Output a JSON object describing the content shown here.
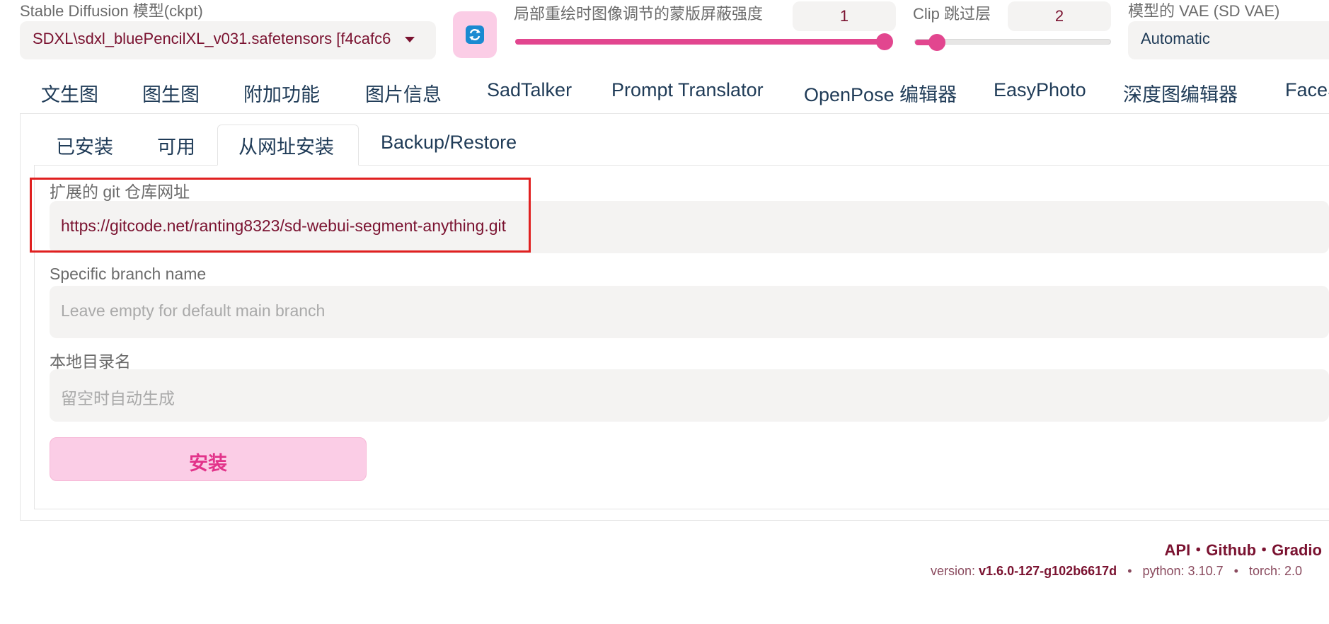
{
  "header": {
    "ckpt_label": "Stable Diffusion 模型(ckpt)",
    "ckpt_value": "SDXL\\sdxl_bluePencilXL_v031.safetensors [f4cafc6",
    "refresh_icon": "refresh-icon",
    "mask_strength_label": "局部重绘时图像调节的蒙版屏蔽强度",
    "mask_strength_value": "1",
    "mask_strength_fraction": 1.0,
    "clip_skip_label": "Clip 跳过层",
    "clip_skip_value": "2",
    "clip_skip_fraction": 0.12,
    "vae_label": "模型的 VAE (SD VAE)",
    "vae_value": "Automatic"
  },
  "main_tabs": [
    {
      "label": "文生图"
    },
    {
      "label": "图生图"
    },
    {
      "label": "附加功能"
    },
    {
      "label": "图片信息"
    },
    {
      "label": "SadTalker"
    },
    {
      "label": "Prompt Translator"
    },
    {
      "label": "OpenPose 编辑器"
    },
    {
      "label": "EasyPhoto"
    },
    {
      "label": "深度图编辑器"
    },
    {
      "label": "FaceS"
    }
  ],
  "sub_tabs": [
    {
      "label": "已安装"
    },
    {
      "label": "可用"
    },
    {
      "label": "从网址安装",
      "active": true
    },
    {
      "label": "Backup/Restore"
    }
  ],
  "form": {
    "git_url_label": "扩展的 git 仓库网址",
    "git_url_value": "https://gitcode.net/ranting8323/sd-webui-segment-anything.git",
    "branch_label": "Specific branch name",
    "branch_placeholder": "Leave empty for default main branch",
    "dir_label": "本地目录名",
    "dir_placeholder": "留空时自动生成",
    "install_label": "安装"
  },
  "footer": {
    "links": "API・Github・Gradio",
    "version_label": "version: ",
    "version_value": "v1.6.0-127-g102b6617d",
    "python": "python: 3.10.7",
    "torch": "torch: 2.0"
  },
  "colors": {
    "accent": "#e2468f",
    "accent_light": "#fbcde6",
    "text_primary": "#1f3b57",
    "value_text": "#7a1230",
    "highlight": "#e02020"
  }
}
